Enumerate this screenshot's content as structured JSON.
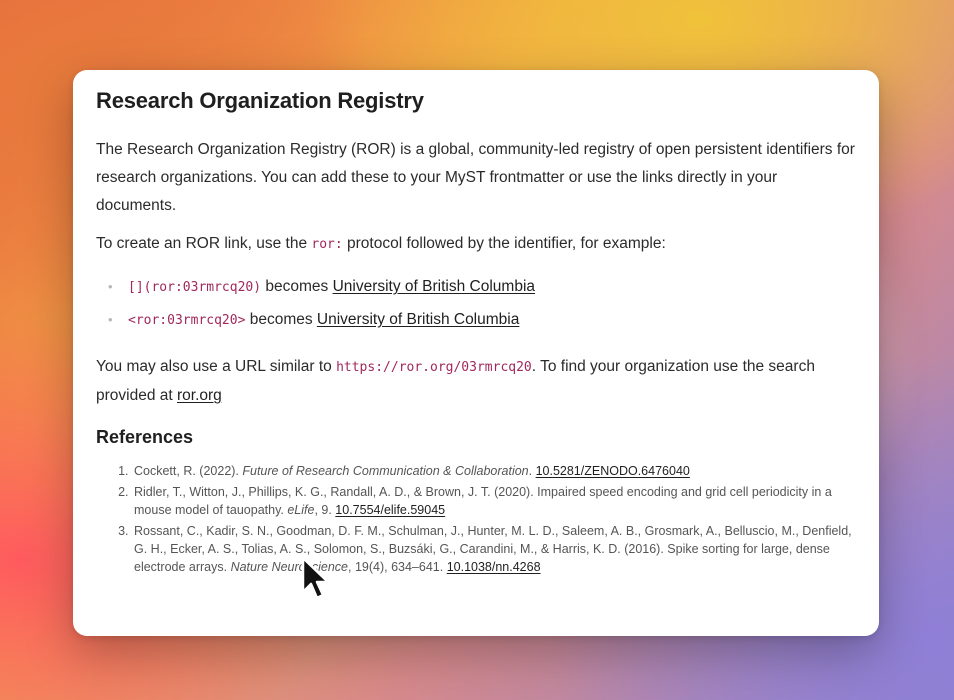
{
  "article": {
    "title": "Research Organization Registry",
    "intro": "The Research Organization Registry (ROR) is a global, community-led registry of open persistent identifiers for research organizations. You can add these to your MyST frontmatter or use the links directly in your documents.",
    "howto": {
      "before": "To create an ROR link, use the ",
      "code": "ror:",
      "after": " protocol followed by the identifier, for example:"
    },
    "examples": [
      {
        "code": "[](ror:03rmrcq20)",
        "middle": " becomes ",
        "link": "University of British Columbia"
      },
      {
        "code": "<ror:03rmrcq20>",
        "middle": " becomes ",
        "link": "University of British Columbia"
      }
    ],
    "url_paragraph": {
      "before": "You may also use a URL similar to ",
      "code": "https://ror.org/03rmrcq20",
      "middle": ". To find your organization use the search provided at ",
      "link": "ror.org"
    },
    "bullet_char": "•"
  },
  "references": {
    "heading": "References",
    "items": [
      {
        "authors": "Cockett, R. (2022). ",
        "title": "Future of Research Communication & Collaboration",
        "rest": ". ",
        "doi": "10.5281/ZENODO.6476040"
      },
      {
        "authors": "Ridler, T., Witton, J., Phillips, K. G., Randall, A. D., & Brown, J. T. (2020). Impaired speed encoding and grid cell periodicity in a mouse model of tauopathy. ",
        "title": "eLife",
        "rest": ", 9. ",
        "doi": "10.7554/elife.59045"
      },
      {
        "authors": "Rossant, C., Kadir, S. N., Goodman, D. F. M., Schulman, J., Hunter, M. L. D., Saleem, A. B., Grosmark, A., Belluscio, M., Denfield, G. H., Ecker, A. S., Tolias, A. S., Solomon, S., Buzsáki, G., Carandini, M., & Harris, K. D. (2016). Spike sorting for large, dense electrode arrays. ",
        "title": "Nature Neuroscience",
        "rest": ", 19(4), 634–641. ",
        "doi": "10.1038/nn.4268"
      }
    ]
  },
  "cursor": {
    "icon": "arrow-cursor-icon"
  }
}
